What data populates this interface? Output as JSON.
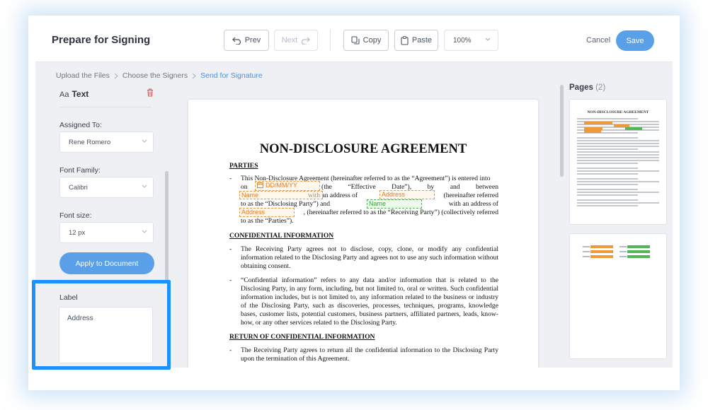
{
  "header": {
    "title": "Prepare for Signing",
    "prev_label": "Prev",
    "next_label": "Next",
    "copy_label": "Copy",
    "paste_label": "Paste",
    "zoom_value": "100%",
    "cancel_label": "Cancel",
    "save_label": "Save"
  },
  "breadcrumb": {
    "items": [
      "Upload the Files",
      "Choose the Signers",
      "Send for Signature"
    ]
  },
  "left_panel": {
    "type_prefix": "Aa",
    "type_label": "Text",
    "assigned_label": "Assigned To:",
    "assigned_value": "Rene Romero",
    "font_family_label": "Font Family:",
    "font_family_value": "Calibri",
    "font_size_label": "Font size:",
    "font_size_value": "12 px",
    "apply_label": "Apply to Document",
    "label_title": "Label",
    "label_value": "Address"
  },
  "document": {
    "title": "NON-DISCLOSURE AGREEMENT",
    "parties_heading": "PARTIES",
    "parties_l1": "This Non-Disclosure Agreement (hereinafter referred to as the “Agreement”) is entered into",
    "parties_l2a": "on",
    "parties_l2b": "(the “Effective Date”), by and between",
    "parties_l3": "with an address of",
    "parties_l3b": "(hereinafter referred",
    "parties_l4a": "to as the “Disclosing Party”) and",
    "parties_l4b": "with an address of",
    "parties_l5": ", (hereinafter referred to as the “Receiving Party”) (collectively referred",
    "parties_l6": "to as the “Parties”).",
    "confidential_heading": "CONFIDENTIAL INFORMATION",
    "conf_p1": "The Receiving Party agrees not to disclose, copy, clone, or modify any confidential information related to the Disclosing Party and agrees not to use any such information without obtaining consent.",
    "conf_p2": "“Confidential information” refers to any data and/or information that is related to the Disclosing Party, in any form, including, but not limited to, oral or written. Such confidential information includes, but is not limited to, any information related to the business or industry of the Disclosing Party, such as discoveries, processes, techniques, programs, knowledge bases, customer lists, potential customers, business partners, affiliated partners, leads, know-how, or any other services related to the Disclosing Party.",
    "return_heading": "RETURN OF CONFIDENTIAL INFORMATION",
    "return_p1": "The Receiving Party agrees to return all the confidential information to the Disclosing Party upon the termination of this Agreement.",
    "fields": {
      "date": "DD/MM/YY",
      "name1": "Name",
      "address1": "Address",
      "name2": "Name",
      "address2": "Address"
    }
  },
  "pages_panel": {
    "title": "Pages",
    "count": "(2)",
    "thumb_title": "NON-DISCLOSURE AGREEMENT"
  },
  "colors": {
    "accent": "#5aa0e8",
    "highlight_border": "#1e90ff",
    "field_orange": "#e89a4a",
    "field_green": "#58b158",
    "delete_red": "#e05555"
  },
  "icons": [
    "undo-icon",
    "redo-icon",
    "copy-icon",
    "paste-icon",
    "chevron-down-icon",
    "chevron-right-icon",
    "trash-icon",
    "calendar-icon"
  ]
}
